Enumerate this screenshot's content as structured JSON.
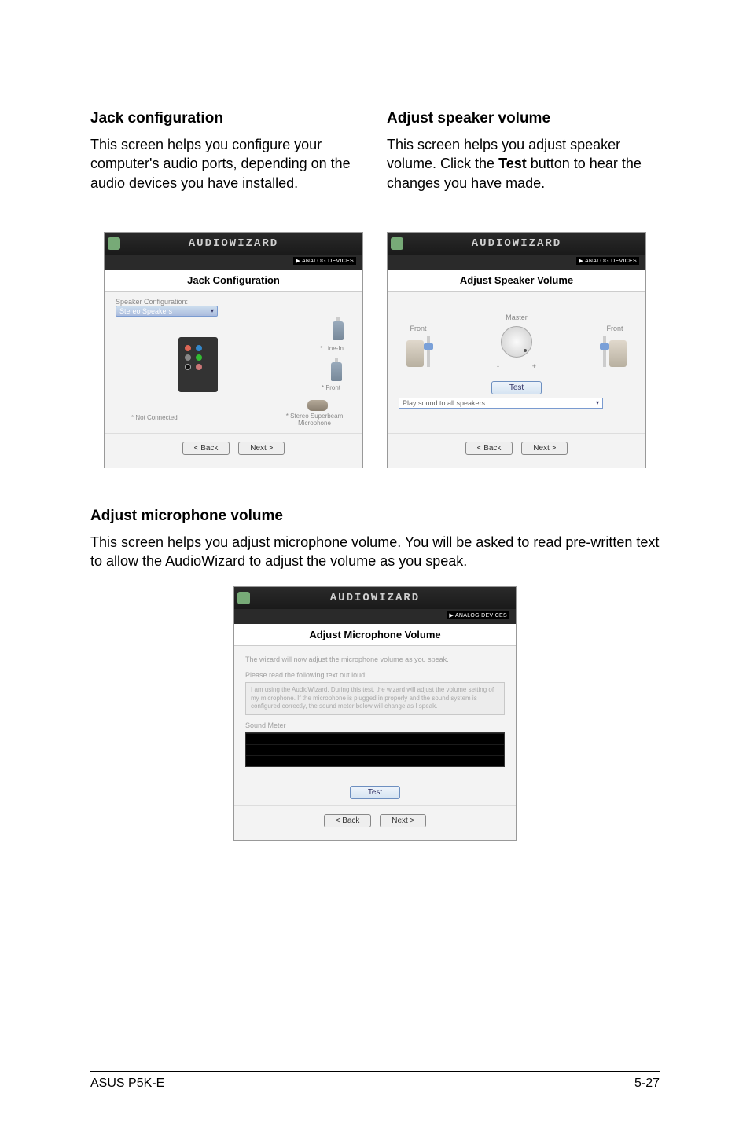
{
  "section1": {
    "heading": "Jack configuration",
    "desc": "This screen helps you configure your computer's audio ports, depending on the audio devices you have installed."
  },
  "section2": {
    "heading": "Adjust speaker volume",
    "desc_pre": "This screen helps you adjust speaker volume. Click the ",
    "desc_bold": "Test",
    "desc_post": " button to hear the changes you have made."
  },
  "section3": {
    "heading": "Adjust microphone volume",
    "desc": "This screen helps you adjust microphone volume. You will be asked to read pre-written text to allow the AudioWizard to adjust the volume as you speak."
  },
  "wizard_common": {
    "title": "AUDIOWIZARD",
    "brand": "▶ ANALOG DEVICES",
    "back": "< Back",
    "next": "Next >",
    "test": "Test"
  },
  "jack_wizard": {
    "header": "Jack Configuration",
    "config_label": "Speaker Configuration:",
    "config_value": "Stereo Speakers",
    "port_linein": "* Line-In",
    "port_front": "* Front",
    "port_notconn": "* Not Connected",
    "port_mic": "* Stereo Superbeam Microphone"
  },
  "speaker_wizard": {
    "header": "Adjust Speaker Volume",
    "front_l": "Front",
    "front_r": "Front",
    "master": "Master",
    "play_label": "Play sound to all speakers"
  },
  "mic_wizard": {
    "header": "Adjust Microphone Volume",
    "line1": "The wizard will now adjust the microphone volume as you speak.",
    "line2": "Please read the following text out loud:",
    "readtext": "I am using the AudioWizard. During this test, the wizard will adjust the volume setting of my microphone. If the microphone is plugged in properly and the sound system is configured correctly, the sound meter below will change as I speak.",
    "meter_label": "Sound Meter"
  },
  "footer": {
    "left": "ASUS P5K-E",
    "right": "5-27"
  }
}
